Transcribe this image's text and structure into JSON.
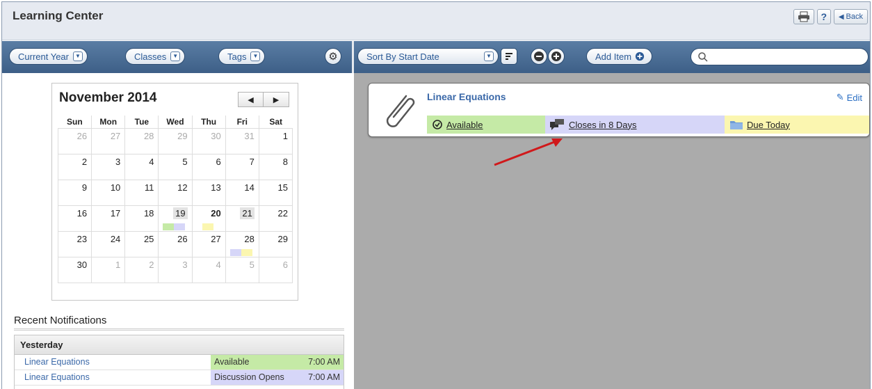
{
  "header": {
    "title": "Learning Center",
    "back_label": "Back",
    "help_label": "?"
  },
  "toolbar": {
    "current_year": "Current Year",
    "classes": "Classes",
    "tags": "Tags",
    "sort": "Sort By Start Date",
    "add_item": "Add Item",
    "search_placeholder": ""
  },
  "calendar": {
    "title": "November 2014",
    "weekdays": [
      "Sun",
      "Mon",
      "Tue",
      "Wed",
      "Thu",
      "Fri",
      "Sat"
    ],
    "weeks": [
      [
        "26",
        "27",
        "28",
        "29",
        "30",
        "31",
        "1"
      ],
      [
        "2",
        "3",
        "4",
        "5",
        "6",
        "7",
        "8"
      ],
      [
        "9",
        "10",
        "11",
        "12",
        "13",
        "14",
        "15"
      ],
      [
        "16",
        "17",
        "18",
        "19",
        "20",
        "21",
        "22"
      ],
      [
        "23",
        "24",
        "25",
        "26",
        "27",
        "28",
        "29"
      ],
      [
        "30",
        "1",
        "2",
        "3",
        "4",
        "5",
        "6"
      ]
    ]
  },
  "notifications": {
    "title": "Recent Notifications",
    "group": "Yesterday",
    "rows": [
      {
        "name": "Linear Equations",
        "status": "Available",
        "time": "7:00 AM"
      },
      {
        "name": "Linear Equations",
        "status": "Discussion Opens",
        "time": "7:00 AM"
      }
    ]
  },
  "item": {
    "title": "Linear Equations",
    "edit_label": "Edit",
    "available": "Available",
    "closes": "Closes in 8 Days",
    "due": "Due Today"
  },
  "colors": {
    "available": "#c5eaa6",
    "discussion": "#d6d6f8",
    "due": "#fbf6b0",
    "toolbar": "#4a6d96",
    "link": "#3a68a8",
    "arrow": "#d0191b"
  }
}
